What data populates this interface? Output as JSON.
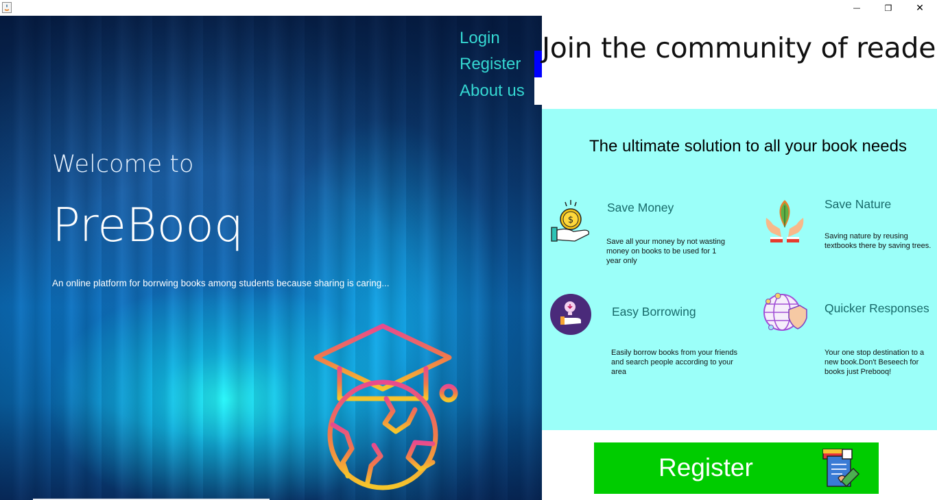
{
  "window": {
    "minimize_glyph": "—",
    "maximize_glyph": "❐",
    "close_glyph": "✕"
  },
  "nav": {
    "login": "Login",
    "register": "Register",
    "about": "About us"
  },
  "hero": {
    "welcome": "Welcome to",
    "brand": "PreBooq",
    "tagline": "An online platform for borrwing books among students because sharing is caring..."
  },
  "right": {
    "headline": "Join the community of readers",
    "panel_title": "The ultimate solution to all your book needs",
    "features": [
      {
        "icon": "money-hand-icon",
        "title": "Save Money",
        "desc": "Save all your money by not wasting money on books to be used for 1 year only"
      },
      {
        "icon": "leaf-hands-icon",
        "title": "Save Nature",
        "desc": "Saving nature by reusing textbooks there by saving trees."
      },
      {
        "icon": "lightbulb-hand-icon",
        "title": "Easy Borrowing",
        "desc": "Easily borrow books from your friends and search people according to your area"
      },
      {
        "icon": "globe-shield-icon",
        "title": "Quicker Responses",
        "desc": "Your one stop destination to a new book.Don't Beseech for books just Prebooq!"
      }
    ],
    "register_button": "Register"
  },
  "colors": {
    "nav_link": "#35d8d2",
    "feature_panel_bg": "#9bfff9",
    "feature_title": "#176a6a",
    "register_bg": "#00cc00",
    "blue_mark": "#0000ff"
  }
}
